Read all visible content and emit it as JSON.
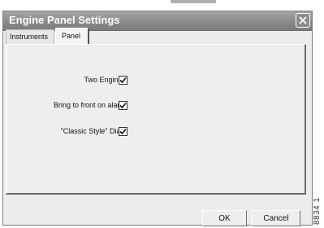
{
  "window": {
    "title": "Engine Panel Settings",
    "close_icon": "close-icon"
  },
  "tabs": [
    {
      "label": "Instruments",
      "selected": false
    },
    {
      "label": "Panel",
      "selected": true
    }
  ],
  "panel": {
    "options": [
      {
        "label": "Two Engines",
        "checked": true
      },
      {
        "label": "Bring to front on alarm",
        "checked": true
      },
      {
        "label": "\"Classic Style\" Dials",
        "checked": true
      }
    ]
  },
  "buttons": {
    "ok_label": "OK",
    "cancel_label": "Cancel"
  },
  "figure_code": "8834 1",
  "colors": {
    "titlebar": "#8c8c8c",
    "dialog_bg": "#ececec",
    "title_text": "#ffffff"
  }
}
